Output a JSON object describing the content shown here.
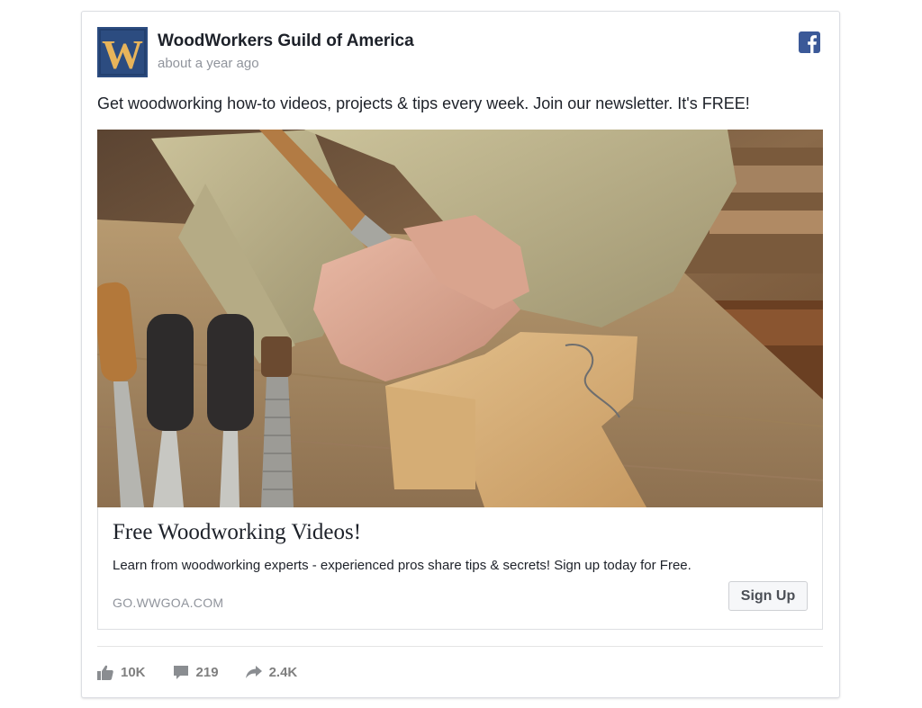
{
  "post": {
    "page_name": "WoodWorkers Guild of America",
    "timestamp": "about a year ago",
    "text": "Get woodworking how-to videos, projects & tips every week. Join our newsletter. It's FREE!",
    "avatar_letter": "W",
    "brand_color": "#3b5998"
  },
  "link": {
    "title": "Free Woodworking Videos!",
    "description": "Learn from woodworking experts - experienced pros share tips & secrets! Sign up today for Free.",
    "domain": "GO.WWGOA.COM",
    "cta_label": "Sign Up"
  },
  "engagement": {
    "likes": "10K",
    "comments": "219",
    "shares": "2.4K"
  },
  "icons": {
    "facebook": "facebook-icon",
    "like": "thumbs-up-icon",
    "comment": "comment-icon",
    "share": "share-arrow-icon"
  }
}
